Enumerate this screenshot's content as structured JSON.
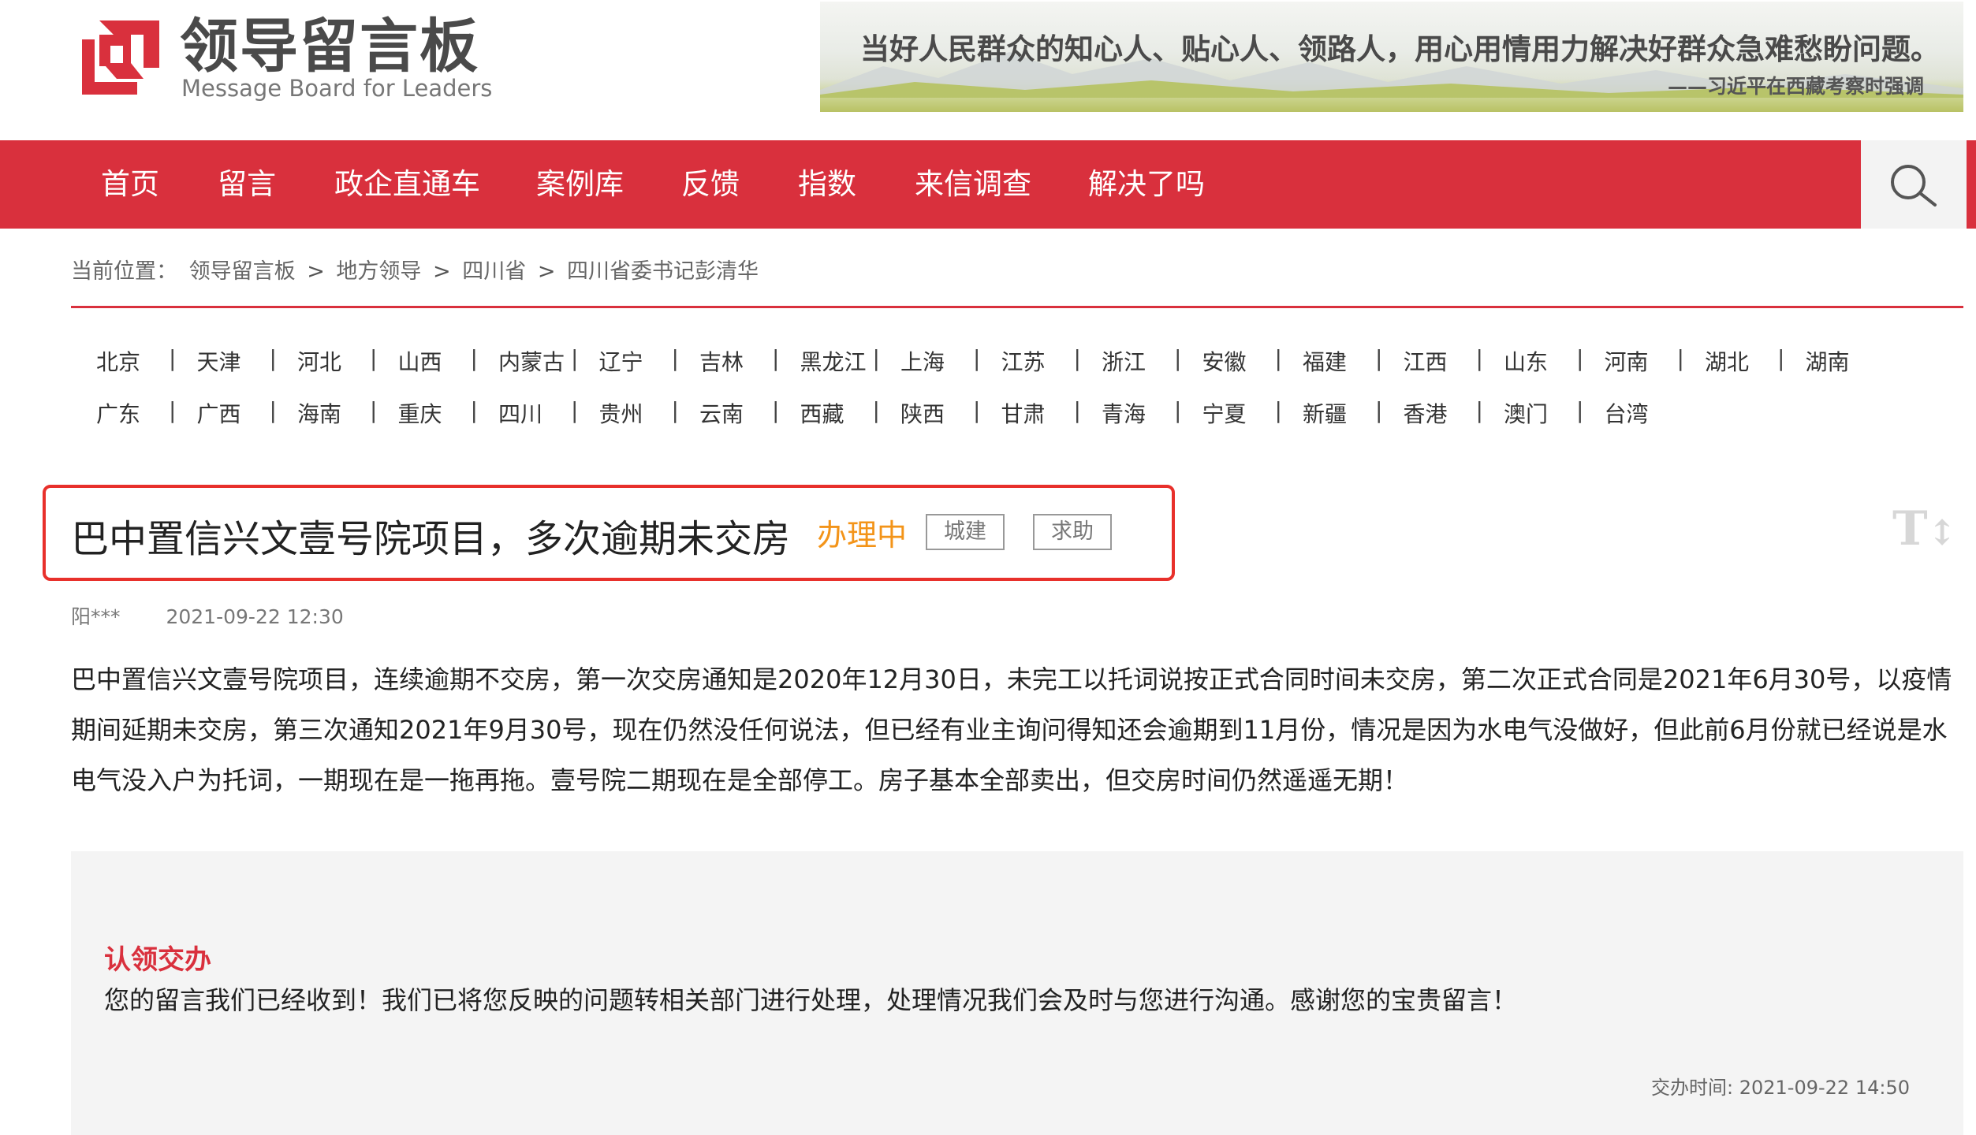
{
  "header": {
    "logo_cn": "领导留言板",
    "logo_en": "Message Board for Leaders",
    "banner_quote": "当好人民群众的知心人、贴心人、领路人，用心用情用力解决好群众急难愁盼问题。",
    "banner_attrib": "——习近平在西藏考察时强调"
  },
  "nav": {
    "items": [
      "首页",
      "留言",
      "政企直通车",
      "案例库",
      "反馈",
      "指数",
      "来信调查",
      "解决了吗"
    ],
    "search_icon": "search-icon",
    "bg_color": "#d9303d"
  },
  "breadcrumb": {
    "prefix": "当前位置：",
    "items": [
      "领导留言板",
      "地方领导",
      "四川省",
      "四川省委书记彭清华"
    ],
    "separator": ">"
  },
  "provinces": {
    "row1": [
      "北京",
      "天津",
      "河北",
      "山西",
      "内蒙古",
      "辽宁",
      "吉林",
      "黑龙江",
      "上海",
      "江苏",
      "浙江",
      "安徽",
      "福建",
      "江西",
      "山东",
      "河南",
      "湖北",
      "湖南"
    ],
    "row2": [
      "广东",
      "广西",
      "海南",
      "重庆",
      "四川",
      "贵州",
      "云南",
      "西藏",
      "陕西",
      "甘肃",
      "青海",
      "宁夏",
      "新疆",
      "香港",
      "澳门",
      "台湾"
    ],
    "separator": "|"
  },
  "message": {
    "title": "巴中置信兴文壹号院项目，多次逾期未交房",
    "status": "办理中",
    "tags": [
      "城建",
      "求助"
    ],
    "author": "阳***",
    "date": "2021-09-22 12:30",
    "body": "巴中置信兴文壹号院项目，连续逾期不交房，第一次交房通知是2020年12月30日，未完工以托词说按正式合同时间未交房，第二次正式合同是2021年6月30号，以疫情期间延期未交房，第三次通知2021年9月30号，现在仍然没任何说法，但已经有业主询问得知还会逾期到11月份，情况是因为水电气没做好，但此前6月份就已经说是水电气没入户为托词，一期现在是一拖再拖。壹号院二期现在是全部停工。房子基本全部卖出，但交房时间仍然遥遥无期！",
    "font_toggle": "T"
  },
  "reply": {
    "title": "认领交办",
    "text": "您的留言我们已经收到！我们已将您反映的问题转相关部门进行处理，处理情况我们会及时与您进行沟通。感谢您的宝贵留言！",
    "time_label": "交办时间: 2021-09-22 14:50"
  }
}
